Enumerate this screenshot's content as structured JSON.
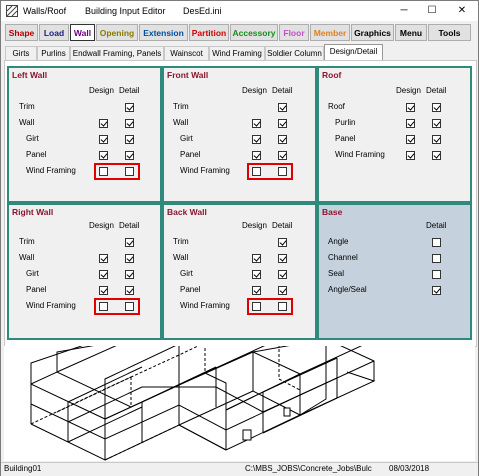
{
  "window": {
    "app_title": "Walls/Roof",
    "editor_title": "Building Input Editor",
    "file_name": "DesEd.ini",
    "minimize": "─",
    "maximize": "☐",
    "close": "✕"
  },
  "menu": [
    {
      "label": "Shape",
      "color": "#b40000"
    },
    {
      "label": "Load",
      "color": "#1a237e"
    },
    {
      "label": "Wall",
      "color": "#6a0080"
    },
    {
      "label": "Opening",
      "color": "#8a7a00"
    },
    {
      "label": "Extension",
      "color": "#0050a0"
    },
    {
      "label": "Partition",
      "color": "#d00000"
    },
    {
      "label": "Accessory",
      "color": "#1a8a20"
    },
    {
      "label": "Floor",
      "color": "#c050c8"
    },
    {
      "label": "Member",
      "color": "#e08020"
    },
    {
      "label": "Graphics",
      "color": "#000000"
    },
    {
      "label": "Menu",
      "color": "#000000"
    },
    {
      "label": "Tools",
      "color": "#000000"
    }
  ],
  "tabs": [
    "Girts",
    "Purlins",
    "Endwall Framing, Panels",
    "Wainscot",
    "Wind Framing",
    "Soldier Column",
    "Design/Detail"
  ],
  "headers": {
    "design": "Design",
    "detail": "Detail"
  },
  "panels": {
    "left_wall": {
      "title": "Left Wall",
      "rows": [
        {
          "label": "Trim",
          "design": null,
          "detail": true
        },
        {
          "label": "Wall",
          "design": true,
          "detail": true
        },
        {
          "label": "Girt",
          "design": true,
          "detail": true
        },
        {
          "label": "Panel",
          "design": true,
          "detail": true
        },
        {
          "label": "Wind Framing",
          "design": false,
          "detail": false
        }
      ]
    },
    "front_wall": {
      "title": "Front Wall",
      "rows": [
        {
          "label": "Trim",
          "design": null,
          "detail": true
        },
        {
          "label": "Wall",
          "design": true,
          "detail": true
        },
        {
          "label": "Girt",
          "design": true,
          "detail": true
        },
        {
          "label": "Panel",
          "design": true,
          "detail": true
        },
        {
          "label": "Wind Framing",
          "design": false,
          "detail": false
        }
      ]
    },
    "roof": {
      "title": "Roof",
      "rows": [
        {
          "label": "Roof",
          "design": true,
          "detail": true
        },
        {
          "label": "Purlin",
          "design": true,
          "detail": true
        },
        {
          "label": "Panel",
          "design": true,
          "detail": true
        },
        {
          "label": "Wind Framing",
          "design": true,
          "detail": true
        }
      ]
    },
    "right_wall": {
      "title": "Right Wall",
      "rows": [
        {
          "label": "Trim",
          "design": null,
          "detail": true
        },
        {
          "label": "Wall",
          "design": true,
          "detail": true
        },
        {
          "label": "Girt",
          "design": true,
          "detail": true
        },
        {
          "label": "Panel",
          "design": true,
          "detail": true
        },
        {
          "label": "Wind Framing",
          "design": false,
          "detail": false
        }
      ]
    },
    "back_wall": {
      "title": "Back Wall",
      "rows": [
        {
          "label": "Trim",
          "design": null,
          "detail": true
        },
        {
          "label": "Wall",
          "design": true,
          "detail": true
        },
        {
          "label": "Girt",
          "design": true,
          "detail": true
        },
        {
          "label": "Panel",
          "design": true,
          "detail": true
        },
        {
          "label": "Wind Framing",
          "design": false,
          "detail": false
        }
      ]
    },
    "base": {
      "title": "Base",
      "rows": [
        {
          "label": "Angle",
          "design": null,
          "detail": false
        },
        {
          "label": "Channel",
          "design": null,
          "detail": false
        },
        {
          "label": "Seal",
          "design": null,
          "detail": false
        },
        {
          "label": "Angle/Seal",
          "design": null,
          "detail": true
        }
      ]
    }
  },
  "status": {
    "building": "Building01",
    "path": "C:\\MBS_JOBS\\Concrete_Jobs\\Bulc",
    "date": "08/03/2018"
  }
}
